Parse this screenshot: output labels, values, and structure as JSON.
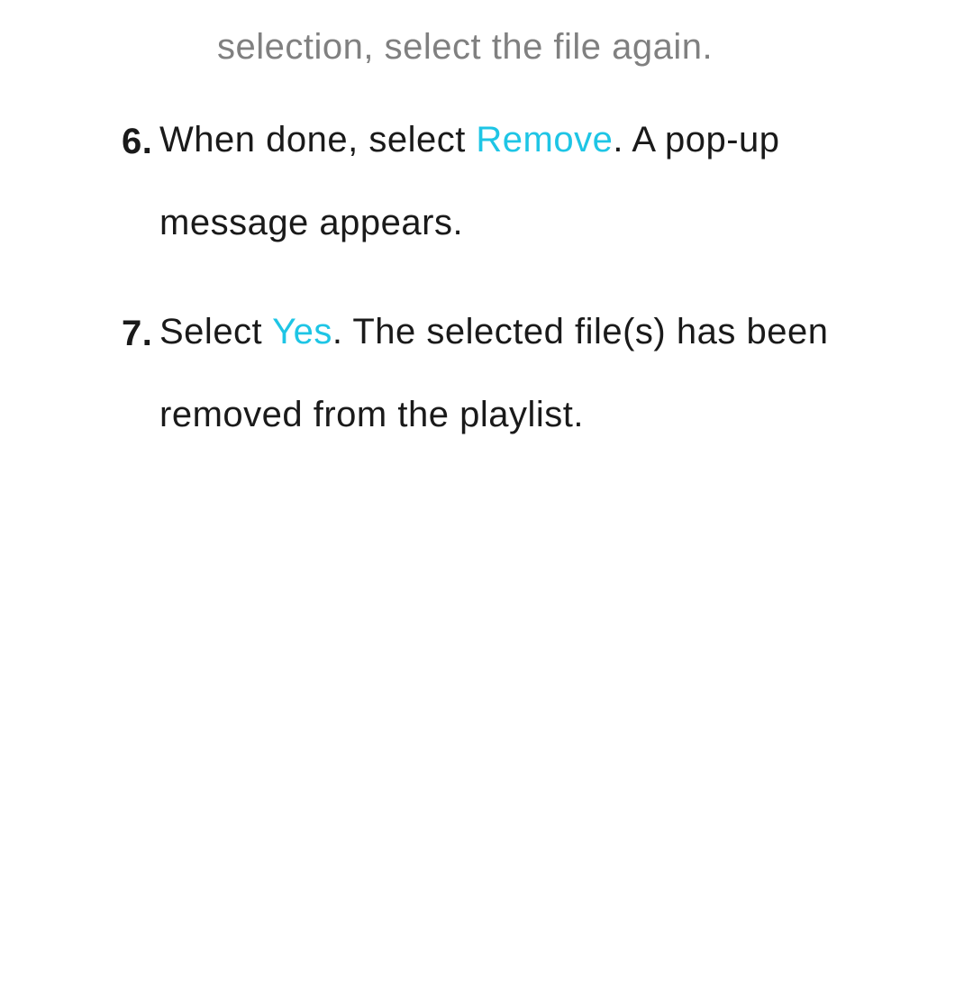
{
  "partial_text": "selection, select the file again.",
  "items": [
    {
      "number": "6.",
      "text_before_1": "When done, select ",
      "highlight_1": "Remove",
      "text_after_1": ". A pop-up message appears."
    },
    {
      "number": "7.",
      "text_before_1": "Select ",
      "highlight_1": "Yes",
      "text_after_1": ". The selected file(s) has been removed from the playlist."
    }
  ]
}
